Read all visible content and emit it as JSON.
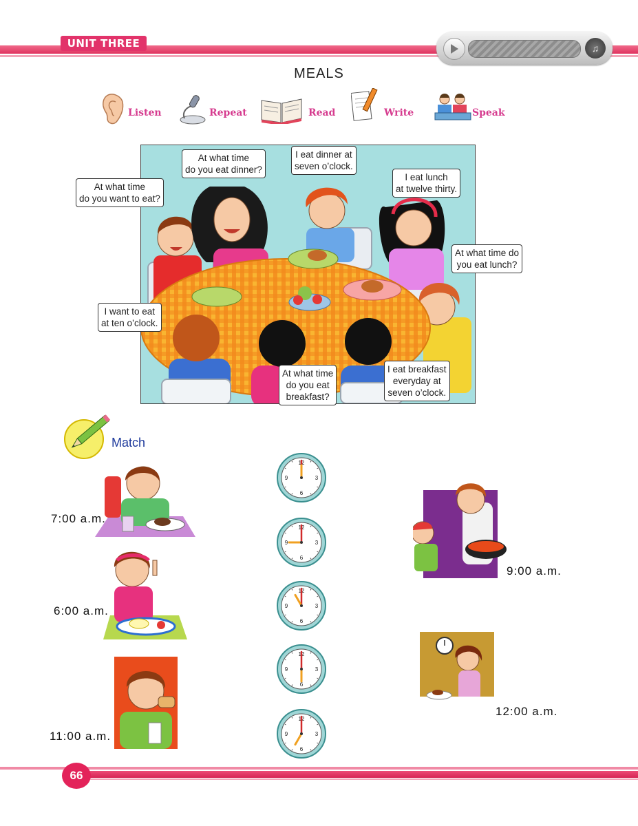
{
  "header": {
    "unit": "UNIT THREE",
    "title": "MEALS"
  },
  "skills": [
    {
      "label": "Listen",
      "icon": "ear-icon"
    },
    {
      "label": "Repeat",
      "icon": "microphone-icon"
    },
    {
      "label": "Read",
      "icon": "book-icon"
    },
    {
      "label": "Write",
      "icon": "pencil-icon"
    },
    {
      "label": "Speak",
      "icon": "speakers-icon"
    }
  ],
  "speech": [
    {
      "l1": "At what time",
      "l2": "do you want to eat?"
    },
    {
      "l1": "At what time",
      "l2": "do you eat dinner?"
    },
    {
      "l1": "I eat dinner at",
      "l2": "seven o’clock."
    },
    {
      "l1": "I eat lunch",
      "l2": "at twelve thirty."
    },
    {
      "l1": "At what time do",
      "l2": "you eat lunch?"
    },
    {
      "l1": "I want to eat",
      "l2": "at ten o’clock."
    },
    {
      "l1": "At what time",
      "l2": "do you eat",
      "l3": "breakfast?"
    },
    {
      "l1": "I eat breakfast",
      "l2": "everyday at",
      "l3": "seven o’clock."
    }
  ],
  "match": {
    "label": "Match",
    "left_times": [
      "7:00 a.m.",
      "6:00 a.m.",
      "11:00 a.m."
    ],
    "right_times": [
      "9:00 a.m.",
      "12:00 a.m."
    ]
  },
  "clocks": [
    {
      "hour": 12,
      "minute": 0
    },
    {
      "hour": 9,
      "minute": 0
    },
    {
      "hour": 11,
      "minute": 0
    },
    {
      "hour": 6,
      "minute": 0
    },
    {
      "hour": 7,
      "minute": 0
    }
  ],
  "page_number": "66",
  "colors": {
    "accent": "#e2336a",
    "skill_text": "#d63c8f",
    "match_text": "#1e3a9c",
    "scene_bg": "#a7dfe0",
    "table": "#f59a1f"
  }
}
